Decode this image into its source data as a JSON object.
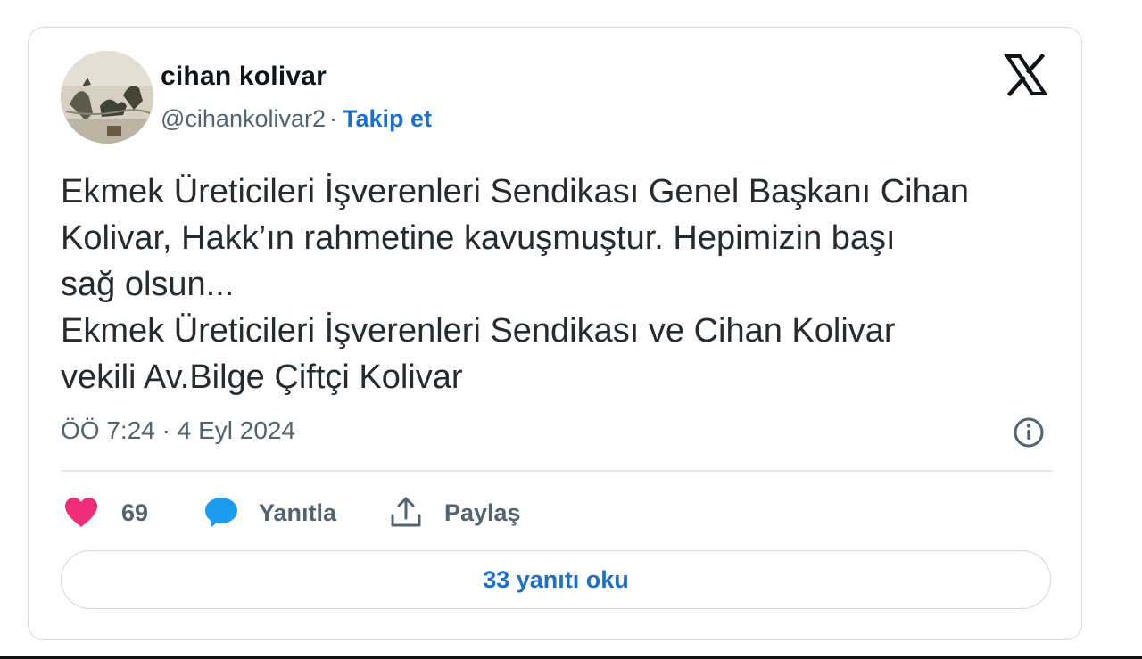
{
  "author": {
    "display_name": "cihan kolivar",
    "handle": "@cihankolivar2",
    "separator": "·",
    "follow_label": "Takip et"
  },
  "tweet": {
    "lines": [
      "Ekmek Üreticileri İşverenleri Sendikası Genel Başkanı Cihan",
      "Kolivar, Hakk’ın rahmetine kavuşmuştur. Hepimizin başı",
      "sağ olsun...",
      "Ekmek Üreticileri İşverenleri Sendikası ve Cihan Kolivar",
      "vekili Av.Bilge Çiftçi Kolivar"
    ],
    "timestamp": "ÖÖ 7:24 · 4 Eyl 2024"
  },
  "actions": {
    "like_count": "69",
    "reply_label": "Yanıtla",
    "share_label": "Paylaş"
  },
  "replies_button_label": "33 yanıtı oku",
  "icons": {
    "brand": "x-logo-icon",
    "info": "info-icon",
    "like": "heart-icon",
    "reply": "speech-bubble-icon",
    "share": "share-icon"
  },
  "colors": {
    "link": "#1d6fc9",
    "heart": "#f02d78",
    "reply_bubble": "#1d9bf0",
    "secondary_text": "#536471"
  }
}
